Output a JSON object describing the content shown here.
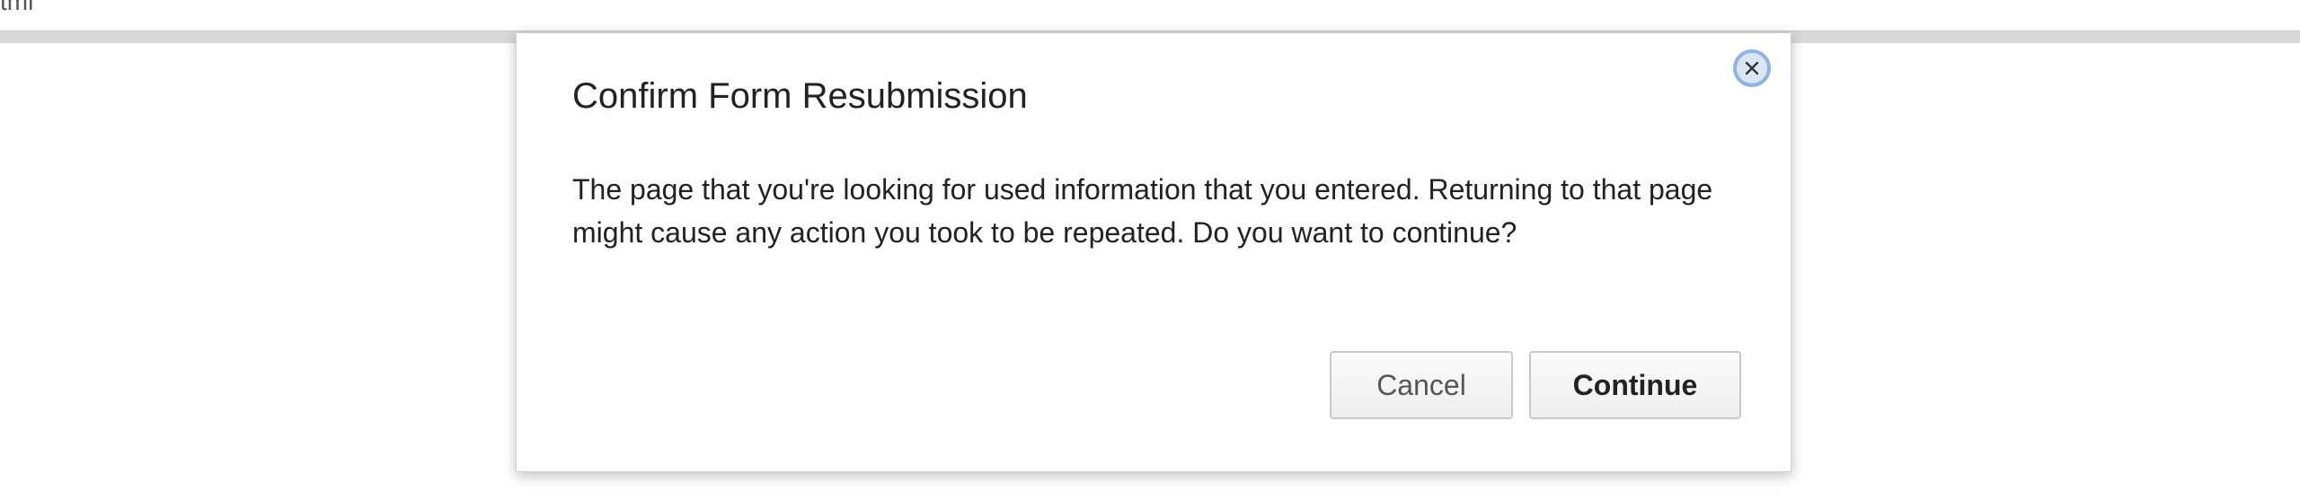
{
  "browser": {
    "partial_text": "tml"
  },
  "dialog": {
    "title": "Confirm Form Resubmission",
    "message": "The page that you're looking for used information that you entered. Returning to that page might cause any action you took to be repeated. Do you want to continue?",
    "close_icon": "close-icon",
    "buttons": {
      "cancel": "Cancel",
      "continue": "Continue"
    }
  },
  "colors": {
    "close_ring": "#8fb2e8",
    "close_fill": "#dbe6f5",
    "button_border": "#c9c9c9"
  }
}
